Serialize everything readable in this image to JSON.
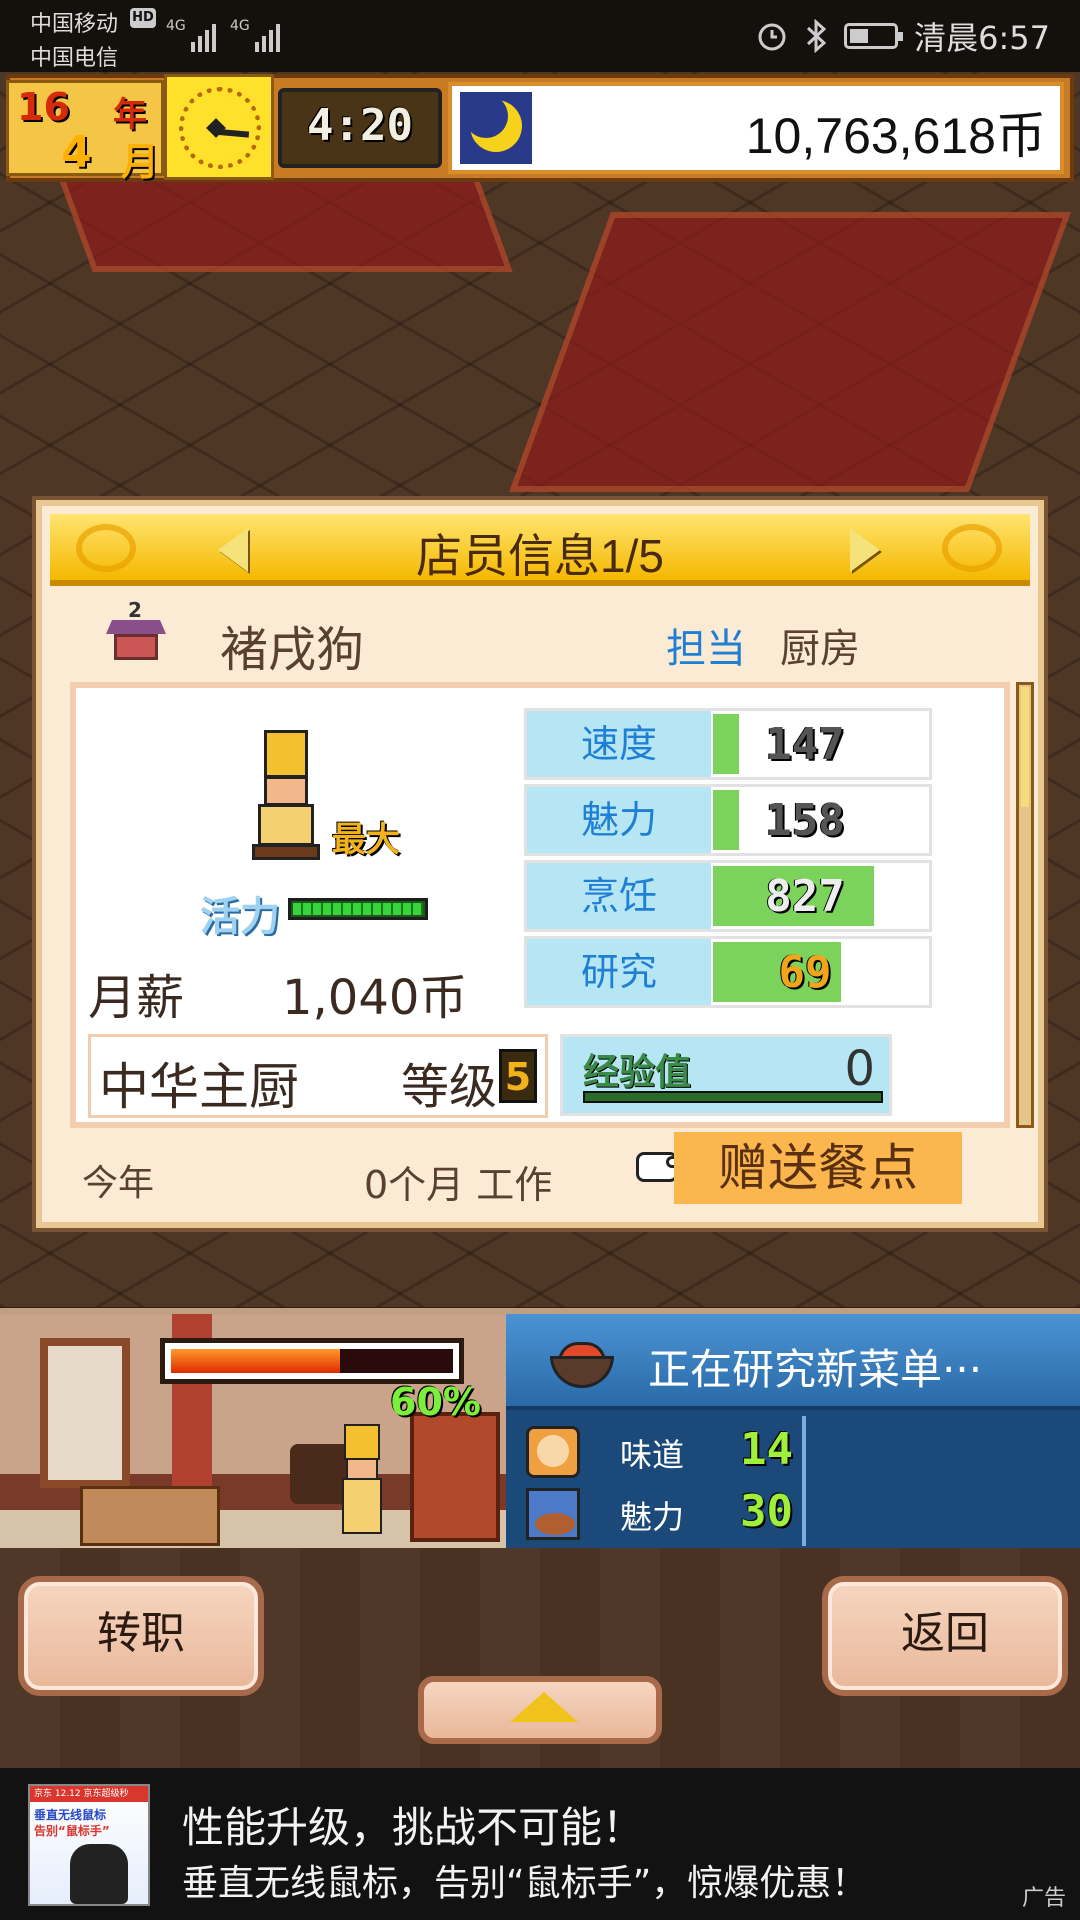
{
  "status_bar": {
    "carrier1": "中国移动",
    "carrier2": "中国电信",
    "hd": "HD",
    "net1": "4G",
    "net2": "4G",
    "time": "清晨6:57"
  },
  "hud": {
    "year": "16",
    "year_label": "年",
    "month": "4",
    "month_label": "月",
    "game_time": "4:20",
    "money": "10,763,618币"
  },
  "panel": {
    "title": "店员信息1/5",
    "rank_number": "2",
    "name": "褚戌狗",
    "role_label": "担当",
    "role_value": "厨房",
    "max_label": "最大",
    "vitality_label": "活力",
    "vitality_level": 1.0,
    "salary_label": "月薪",
    "salary_value": "1,040币",
    "stats": [
      {
        "label": "速度",
        "value": "147",
        "fill": 0.12
      },
      {
        "label": "魅力",
        "value": "158",
        "fill": 0.12
      },
      {
        "label": "烹饪",
        "value": "827",
        "fill": 0.75
      },
      {
        "label": "研究",
        "value": "69",
        "fill": 0.6
      }
    ],
    "job_title": "中华主厨",
    "level_label": "等级",
    "level_value": "5",
    "exp_label": "经验值",
    "exp_value": "0",
    "this_year_label": "今年",
    "work_label": "0个月 工作",
    "gift_button": "赠送餐点"
  },
  "kitchen": {
    "progress_percent": "60%",
    "progress_fraction": 0.6
  },
  "research": {
    "title": "正在研究新菜单···",
    "rows": [
      {
        "label": "味道",
        "value": "14"
      },
      {
        "label": "魅力",
        "value": "30"
      }
    ]
  },
  "controls": {
    "change_job": "转职",
    "back": "返回"
  },
  "ad": {
    "line1": "性能升级，挑战不可能！",
    "line2": "垂直无线鼠标，告别“鼠标手”，惊爆优惠！",
    "tag": "广告",
    "img_header": "京东 12.12 京东超级秒",
    "img_title1": "垂直无线鼠标",
    "img_title2": "告别“鼠标手”"
  }
}
